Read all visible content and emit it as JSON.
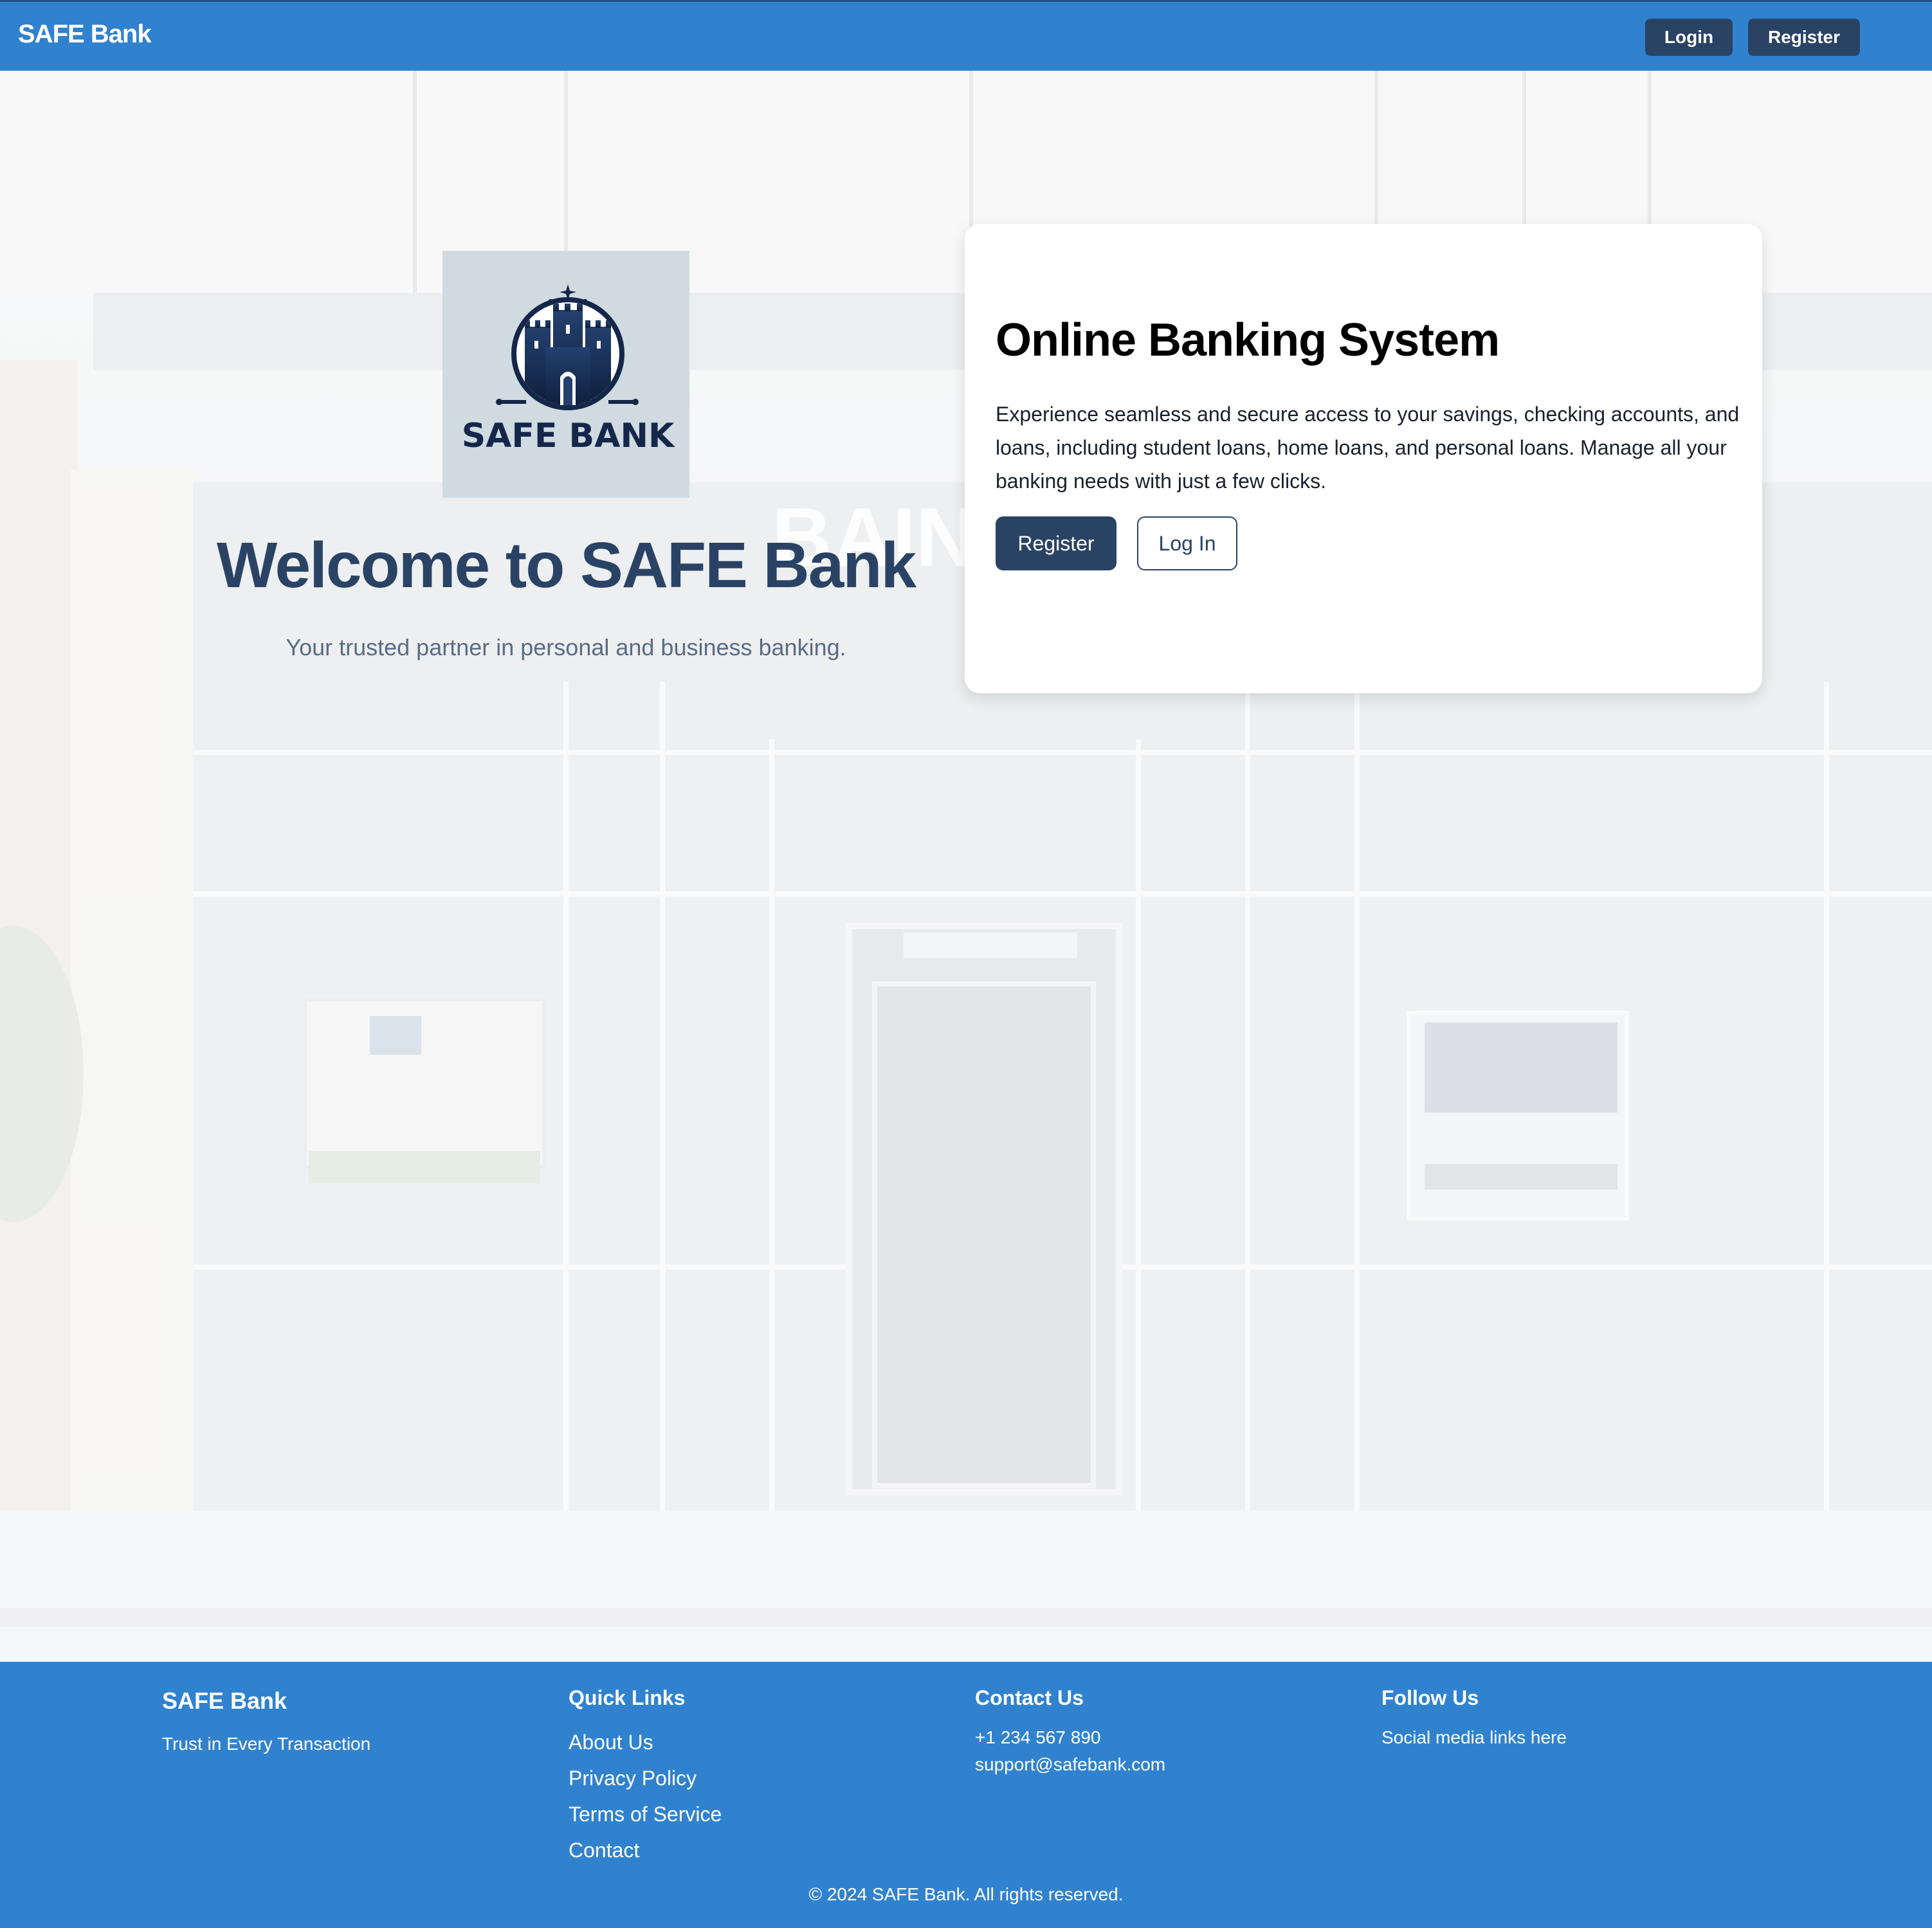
{
  "navbar": {
    "brand": "SAFE Bank",
    "login_label": "Login",
    "register_label": "Register"
  },
  "hero": {
    "logo_text": "SAFE BANK",
    "title": "Welcome to SAFE Bank",
    "subtitle": "Your trusted partner in personal and business banking.",
    "background_sign_text": "BAIN"
  },
  "card": {
    "title": "Online Banking System",
    "description": "Experience seamless and secure access to your savings, checking accounts, and loans, including student loans, home loans, and personal loans. Manage all your banking needs with just a few clicks.",
    "register_label": "Register",
    "login_label": "Log In"
  },
  "footer": {
    "brand": "SAFE Bank",
    "tagline": "Trust in Every Transaction",
    "quick_links_heading": "Quick Links",
    "quick_links": [
      "About Us",
      "Privacy Policy",
      "Terms of Service",
      "Contact"
    ],
    "contact_heading": "Contact Us",
    "phone": "+1 234 567 890",
    "email": "support@safebank.com",
    "follow_heading": "Follow Us",
    "social_text": "Social media links here",
    "copyright": "© 2024 SAFE Bank. All rights reserved."
  },
  "colors": {
    "primary_blue": "#3182ce",
    "navy": "#2a4365",
    "white": "#ffffff"
  },
  "icons": {
    "logo": "castle-logo-icon"
  }
}
